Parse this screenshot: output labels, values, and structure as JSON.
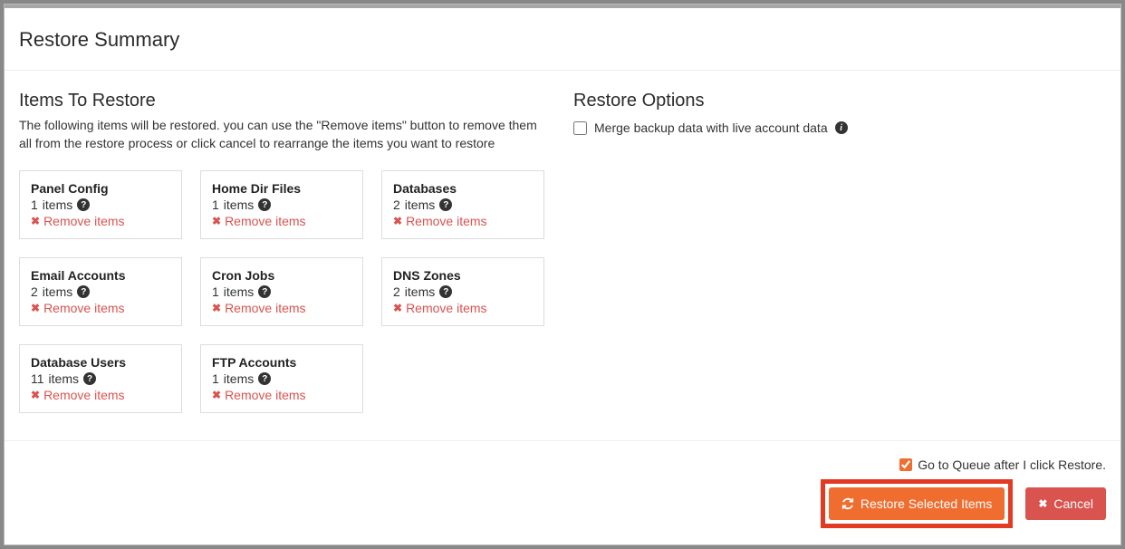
{
  "title": "Restore Summary",
  "left": {
    "heading": "Items To Restore",
    "description": "The following items will be restored. you can use the \"Remove items\" button to remove them all from the restore process or click cancel to rearrange the items you want to restore",
    "remove_label": "Remove items",
    "items_word": "items",
    "cards": [
      {
        "title": "Panel Config",
        "count": 1
      },
      {
        "title": "Home Dir Files",
        "count": 1
      },
      {
        "title": "Databases",
        "count": 2
      },
      {
        "title": "Email Accounts",
        "count": 2
      },
      {
        "title": "Cron Jobs",
        "count": 1
      },
      {
        "title": "DNS Zones",
        "count": 2
      },
      {
        "title": "Database Users",
        "count": 11
      },
      {
        "title": "FTP Accounts",
        "count": 1
      }
    ]
  },
  "right": {
    "heading": "Restore Options",
    "merge_label": "Merge backup data with live account data"
  },
  "footer": {
    "queue_label": "Go to Queue after I click Restore.",
    "restore_label": "Restore Selected Items",
    "cancel_label": "Cancel"
  }
}
